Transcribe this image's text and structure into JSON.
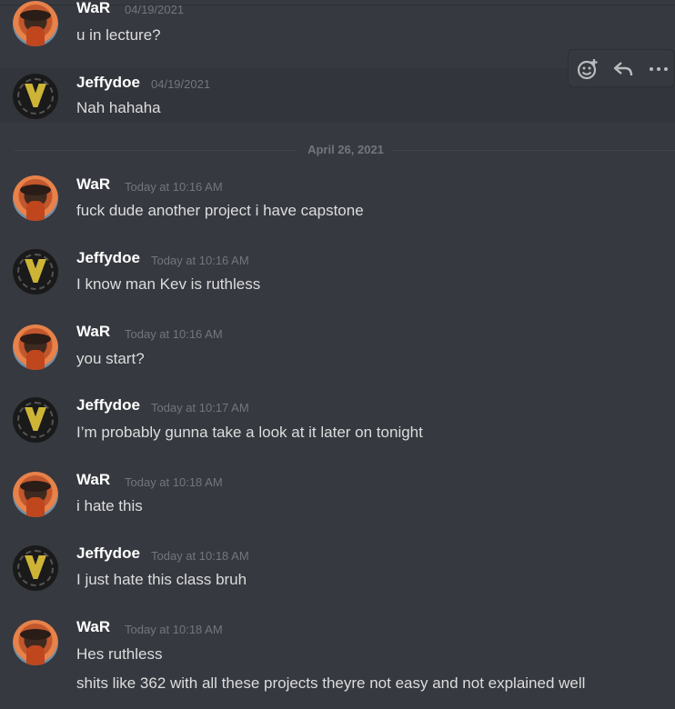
{
  "messages": [
    {
      "author": "WaR",
      "time": "04/19/2021",
      "text": "u in lecture?"
    },
    {
      "author": "Jeffydoe",
      "time": "04/19/2021",
      "text": "Nah hahaha"
    },
    {
      "author": "WaR",
      "time": "Today at 10:16 AM",
      "text": "fuck dude another project i have capstone"
    },
    {
      "author": "Jeffydoe",
      "time": "Today at 10:16 AM",
      "text": "I know man Kev is ruthless"
    },
    {
      "author": "WaR",
      "time": "Today at 10:16 AM",
      "text": "you start?"
    },
    {
      "author": "Jeffydoe",
      "time": "Today at 10:17 AM",
      "text": "I’m probably gunna take a look at it later on tonight"
    },
    {
      "author": "WaR",
      "time": "Today at 10:18 AM",
      "text": "i hate this"
    },
    {
      "author": "Jeffydoe",
      "time": "Today at 10:18 AM",
      "text": "I just hate this class bruh"
    },
    {
      "author": "WaR",
      "time": "Today at 10:18 AM",
      "text": "Hes ruthless",
      "text2": "shits like 362 with all these projects theyre not easy and not explained well"
    }
  ],
  "date_divider": "April 26, 2021",
  "toolbar": {
    "add_reaction_icon": "add-reaction-icon",
    "reply_icon": "reply-icon",
    "more_icon": "more-icon"
  },
  "colors": {
    "background": "#36393f",
    "username": "#ffffff",
    "timestamp": "#72767d",
    "message_text": "#dcddde"
  }
}
